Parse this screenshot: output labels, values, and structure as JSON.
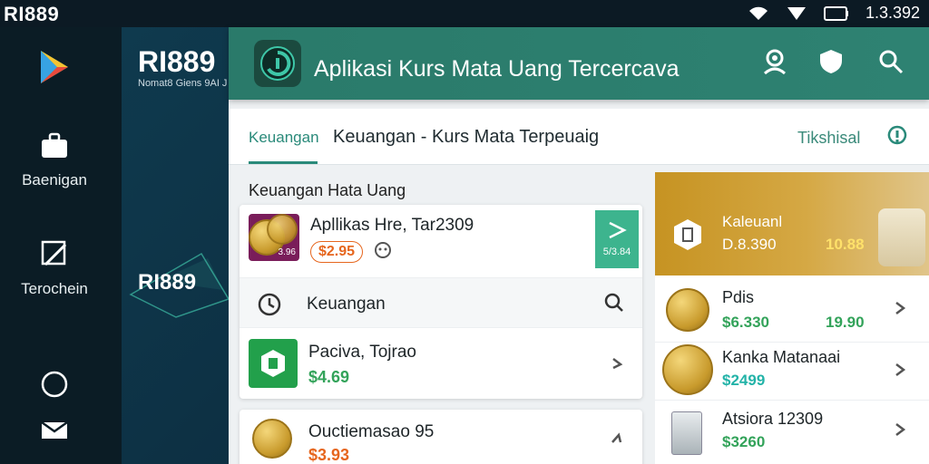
{
  "status_bar": {
    "brand": "RI889",
    "time": "1.3.392"
  },
  "nav_rail": {
    "items": [
      {
        "label": "",
        "icon": "play-store-icon"
      },
      {
        "label": "Baenigan",
        "icon": "briefcase-icon"
      },
      {
        "label": "Terochein",
        "icon": "edit-icon"
      },
      {
        "label": "",
        "icon": "circle-icon"
      },
      {
        "label": "",
        "icon": "mail-icon"
      }
    ]
  },
  "background": {
    "brand": "RI889",
    "subtitle": "Nomat8 Giens 9AI J",
    "brand2": "RI889"
  },
  "app": {
    "title": "Aplikasi Kurs Mata Uang Tercercava",
    "accent": "#2e8272",
    "tabs": {
      "active": "Keuangan",
      "title": "Keuangan - Kurs Mata Terpeuaig",
      "right": "Tikshisal"
    },
    "section_title": "Keuangan Hata Uang",
    "card": {
      "top_item": {
        "name": "Apllikas Hre, Tar2309",
        "price": "$2.95",
        "badge": "3.96",
        "ad": "5/3.84"
      },
      "search_row": {
        "label": "Keuangan"
      },
      "item2": {
        "name": "Paciva, Tojrao",
        "price": "$4.69"
      }
    },
    "card2": {
      "name": "Ouctiemasao 95",
      "price": "$3.93"
    },
    "side": {
      "promo": {
        "title": "Kaleuanl",
        "value": "D.8.390",
        "value2": "10.88"
      },
      "items": [
        {
          "name": "Pdis",
          "price": "$6.330",
          "extra": "19.90"
        },
        {
          "name": "Kanka Matanaai",
          "price": "$2499",
          "extra": ""
        },
        {
          "name": "Atsiora 12309",
          "price": "$3260",
          "extra": ""
        }
      ]
    }
  }
}
